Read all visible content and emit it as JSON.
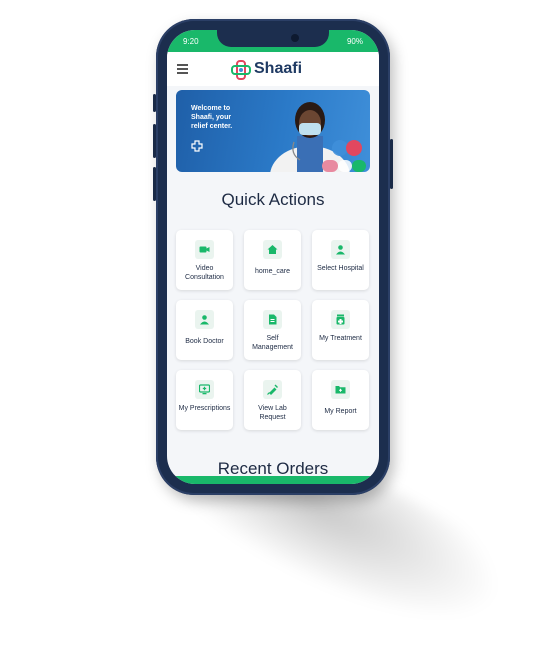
{
  "status_bar": {
    "time": "9:20",
    "battery": "90%"
  },
  "app": {
    "brand": "Shaafi",
    "menu_icon": "hamburger-icon",
    "logo_icon": "shaafi-logo-icon"
  },
  "banner": {
    "line1": "Welcome to",
    "line2": "Shaafi, your",
    "line3": "relief center.",
    "icon": "medical-cross-icon"
  },
  "quick_actions": {
    "title": "Quick Actions",
    "items": [
      {
        "label": "Video Consultation",
        "icon": "video-camera-icon"
      },
      {
        "label": "home_care",
        "icon": "home-icon"
      },
      {
        "label": "Select Hospital",
        "icon": "doctor-icon"
      },
      {
        "label": "Book Doctor",
        "icon": "doctor-icon"
      },
      {
        "label": "Self Management",
        "icon": "document-icon"
      },
      {
        "label": "My Treatment",
        "icon": "medicine-icon"
      },
      {
        "label": "My Prescriptions",
        "icon": "monitor-icon"
      },
      {
        "label": "View Lab Request",
        "icon": "syringe-icon"
      },
      {
        "label": "My Report",
        "icon": "folder-icon"
      }
    ]
  },
  "recent_orders": {
    "title": "Recent Orders"
  },
  "colors": {
    "accent": "#19b86a",
    "brand": "#1f3a63",
    "banner": "#2b7ac8"
  }
}
